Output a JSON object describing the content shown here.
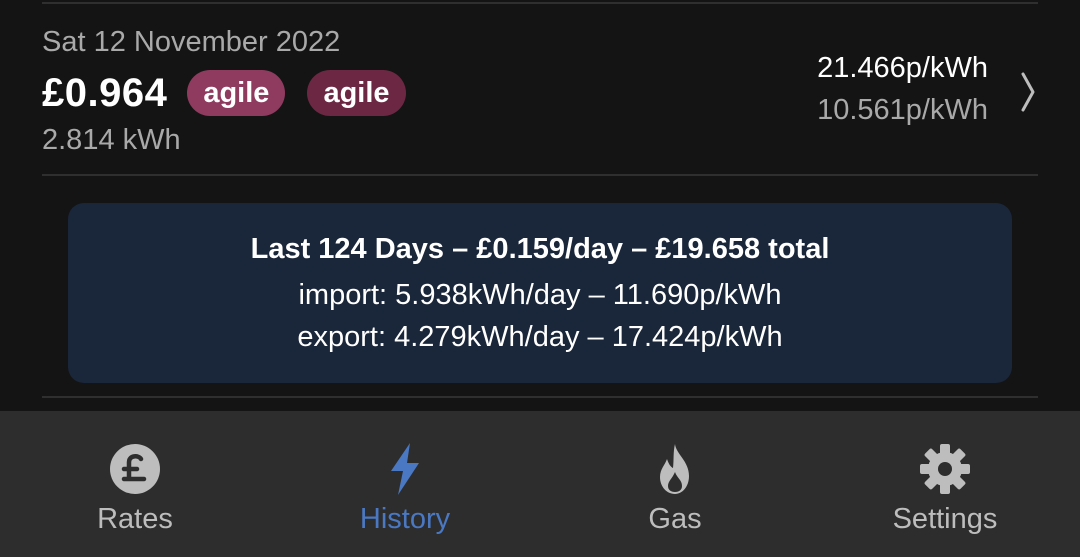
{
  "day": {
    "date": "Sat 12 November 2022",
    "cost": "£0.964",
    "import_tariff": "agile",
    "export_tariff": "agile",
    "usage": "2.814 kWh",
    "import_rate": "21.466p/kWh",
    "export_rate": "10.561p/kWh"
  },
  "summary": {
    "title": "Last 124 Days – £0.159/day – £19.658 total",
    "import_line": "import: 5.938kWh/day – 11.690p/kWh",
    "export_line": "export: 4.279kWh/day – 17.424p/kWh"
  },
  "nav": {
    "items": [
      {
        "label": "Rates",
        "icon": "pound-coin-icon"
      },
      {
        "label": "History",
        "icon": "lightning-bolt-icon",
        "active": true
      },
      {
        "label": "Gas",
        "icon": "flame-icon"
      },
      {
        "label": "Settings",
        "icon": "gear-icon"
      }
    ]
  },
  "colors": {
    "background": "#141414",
    "card": "#1a2639",
    "nav_background": "#2d2d2d",
    "accent": "#4a78c2",
    "import_badge": "#8f3b5f",
    "export_badge": "#6c2843"
  }
}
